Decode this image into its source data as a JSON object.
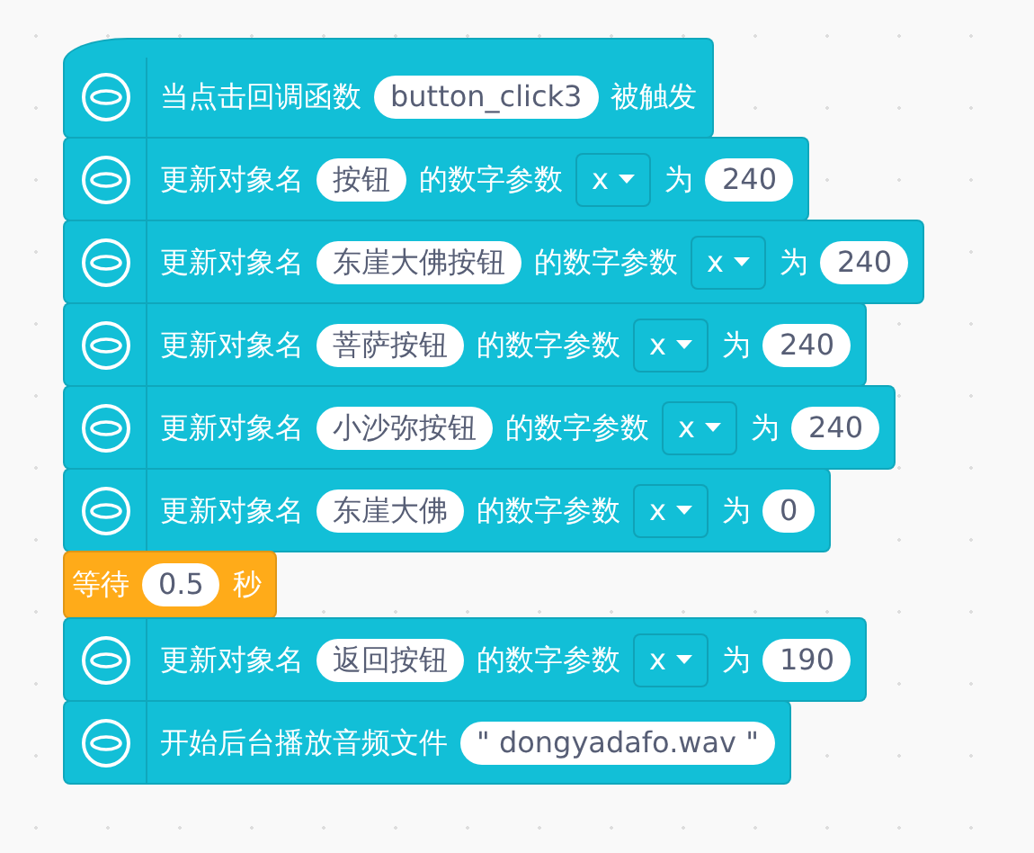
{
  "blocks": [
    {
      "kind": "hat",
      "parts": [
        {
          "kind": "text",
          "text": "当点击回调函数"
        },
        {
          "kind": "input",
          "text": "button_click3"
        },
        {
          "kind": "text",
          "text": "被触发"
        }
      ]
    },
    {
      "kind": "action",
      "parts": [
        {
          "kind": "text",
          "text": "更新对象名"
        },
        {
          "kind": "input",
          "text": "按钮"
        },
        {
          "kind": "text",
          "text": "的数字参数"
        },
        {
          "kind": "dropdown",
          "text": "x"
        },
        {
          "kind": "text",
          "text": "为"
        },
        {
          "kind": "input",
          "text": "240"
        }
      ]
    },
    {
      "kind": "action",
      "parts": [
        {
          "kind": "text",
          "text": "更新对象名"
        },
        {
          "kind": "input",
          "text": "东崖大佛按钮"
        },
        {
          "kind": "text",
          "text": "的数字参数"
        },
        {
          "kind": "dropdown",
          "text": "x"
        },
        {
          "kind": "text",
          "text": "为"
        },
        {
          "kind": "input",
          "text": "240"
        }
      ]
    },
    {
      "kind": "action",
      "parts": [
        {
          "kind": "text",
          "text": "更新对象名"
        },
        {
          "kind": "input",
          "text": "菩萨按钮"
        },
        {
          "kind": "text",
          "text": "的数字参数"
        },
        {
          "kind": "dropdown",
          "text": "x"
        },
        {
          "kind": "text",
          "text": "为"
        },
        {
          "kind": "input",
          "text": "240"
        }
      ]
    },
    {
      "kind": "action",
      "parts": [
        {
          "kind": "text",
          "text": "更新对象名"
        },
        {
          "kind": "input",
          "text": "小沙弥按钮"
        },
        {
          "kind": "text",
          "text": "的数字参数"
        },
        {
          "kind": "dropdown",
          "text": "x"
        },
        {
          "kind": "text",
          "text": "为"
        },
        {
          "kind": "input",
          "text": "240"
        }
      ]
    },
    {
      "kind": "action",
      "parts": [
        {
          "kind": "text",
          "text": "更新对象名"
        },
        {
          "kind": "input",
          "text": "东崖大佛"
        },
        {
          "kind": "text",
          "text": "的数字参数"
        },
        {
          "kind": "dropdown",
          "text": "x"
        },
        {
          "kind": "text",
          "text": "为"
        },
        {
          "kind": "input",
          "text": "0"
        }
      ]
    },
    {
      "kind": "wait",
      "parts": [
        {
          "kind": "text",
          "text": "等待"
        },
        {
          "kind": "input",
          "text": "0.5"
        },
        {
          "kind": "text",
          "text": "秒"
        }
      ]
    },
    {
      "kind": "action",
      "parts": [
        {
          "kind": "text",
          "text": "更新对象名"
        },
        {
          "kind": "input",
          "text": "返回按钮"
        },
        {
          "kind": "text",
          "text": "的数字参数"
        },
        {
          "kind": "dropdown",
          "text": "x"
        },
        {
          "kind": "text",
          "text": "为"
        },
        {
          "kind": "input",
          "text": "190"
        }
      ]
    },
    {
      "kind": "action",
      "parts": [
        {
          "kind": "text",
          "text": "开始后台播放音频文件"
        },
        {
          "kind": "input",
          "text": "\" dongyadafo.wav \""
        }
      ]
    }
  ]
}
